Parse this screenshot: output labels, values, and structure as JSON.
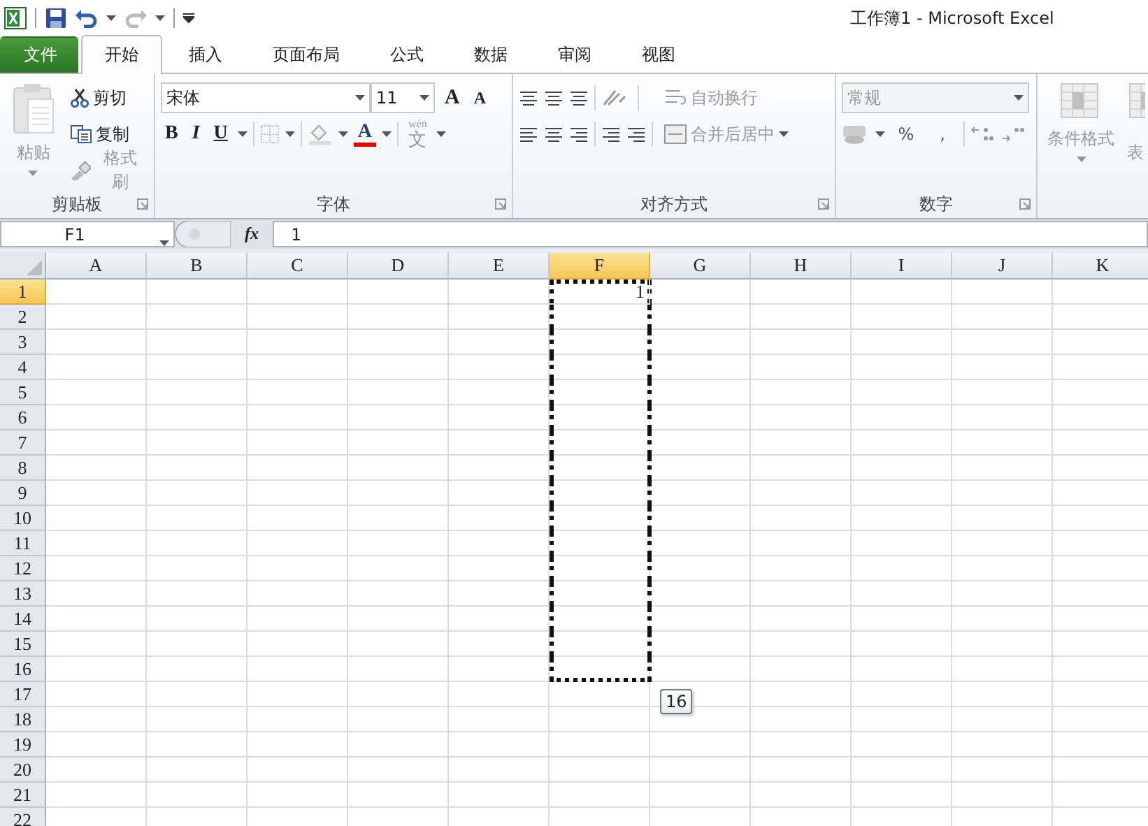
{
  "window": {
    "title": "工作簿1 - Microsoft Excel"
  },
  "tabs": [
    {
      "label": "文件",
      "kind": "file",
      "selected": false
    },
    {
      "label": "开始",
      "kind": "tab",
      "selected": true
    },
    {
      "label": "插入",
      "kind": "tab",
      "selected": false
    },
    {
      "label": "页面布局",
      "kind": "tab",
      "selected": false
    },
    {
      "label": "公式",
      "kind": "tab",
      "selected": false
    },
    {
      "label": "数据",
      "kind": "tab",
      "selected": false
    },
    {
      "label": "审阅",
      "kind": "tab",
      "selected": false
    },
    {
      "label": "视图",
      "kind": "tab",
      "selected": false
    }
  ],
  "ribbon": {
    "groups": [
      {
        "kind": "clipboard",
        "label": "剪贴板",
        "paste": {
          "label": "粘贴",
          "disabled": true
        },
        "items": [
          {
            "label": "剪切",
            "disabled": false
          },
          {
            "label": "复制",
            "disabled": false
          },
          {
            "label": "格式刷",
            "disabled": true
          }
        ]
      },
      {
        "kind": "font",
        "label": "字体",
        "font": "宋体",
        "size": "11",
        "size_buttons": [
          "A",
          "A"
        ],
        "styles": [
          "B",
          "I",
          "U"
        ],
        "font_color": "A",
        "phonetic_hint": "wén",
        "phonetic": "文"
      },
      {
        "kind": "alignment",
        "label": "对齐方式",
        "wrap": {
          "label": "自动换行",
          "disabled": true
        },
        "merge": {
          "label": "合并后居中",
          "disabled": true
        }
      },
      {
        "kind": "number",
        "label": "数字",
        "format": {
          "value": "常规",
          "disabled": true
        },
        "symbols": [
          "%",
          ","
        ]
      },
      {
        "kind": "styles",
        "items": [
          {
            "label": "条件格式",
            "disabled": true
          },
          {
            "label": "表",
            "disabled": true
          }
        ]
      }
    ]
  },
  "formula_bar": {
    "name_box": "F1",
    "fx_label": "fx",
    "formula": "1"
  },
  "sheet": {
    "columns": [
      {
        "label": "A",
        "selected": false
      },
      {
        "label": "B",
        "selected": false
      },
      {
        "label": "C",
        "selected": false
      },
      {
        "label": "D",
        "selected": false
      },
      {
        "label": "E",
        "selected": false
      },
      {
        "label": "F",
        "selected": true
      },
      {
        "label": "G",
        "selected": false
      },
      {
        "label": "H",
        "selected": false
      },
      {
        "label": "I",
        "selected": false
      },
      {
        "label": "J",
        "selected": false
      },
      {
        "label": "K",
        "selected": false
      }
    ],
    "rows": [
      {
        "label": "1",
        "selected": true,
        "in_range": true,
        "cells": [
          {
            "text": "1"
          }
        ]
      },
      {
        "label": "2",
        "selected": false,
        "in_range": true
      },
      {
        "label": "3",
        "selected": false,
        "in_range": true
      },
      {
        "label": "4",
        "selected": false,
        "in_range": true
      },
      {
        "label": "5",
        "selected": false,
        "in_range": true
      },
      {
        "label": "6",
        "selected": false,
        "in_range": true
      },
      {
        "label": "7",
        "selected": false,
        "in_range": true
      },
      {
        "label": "8",
        "selected": false,
        "in_range": true
      },
      {
        "label": "9",
        "selected": false,
        "in_range": true
      },
      {
        "label": "10",
        "selected": false,
        "in_range": true
      },
      {
        "label": "11",
        "selected": false,
        "in_range": true
      },
      {
        "label": "12",
        "selected": false,
        "in_range": true
      },
      {
        "label": "13",
        "selected": false,
        "in_range": true
      },
      {
        "label": "14",
        "selected": false,
        "in_range": true
      },
      {
        "label": "15",
        "selected": false,
        "in_range": true
      },
      {
        "label": "16",
        "selected": false,
        "in_range": true
      },
      {
        "label": "17",
        "selected": false,
        "in_range": false
      },
      {
        "label": "18",
        "selected": false,
        "in_range": false
      },
      {
        "label": "19",
        "selected": false,
        "in_range": false
      },
      {
        "label": "20",
        "selected": false,
        "in_range": false
      },
      {
        "label": "21",
        "selected": false,
        "in_range": false
      },
      {
        "label": "22",
        "selected": false,
        "in_range": false
      }
    ],
    "fill_tooltip": "16"
  }
}
